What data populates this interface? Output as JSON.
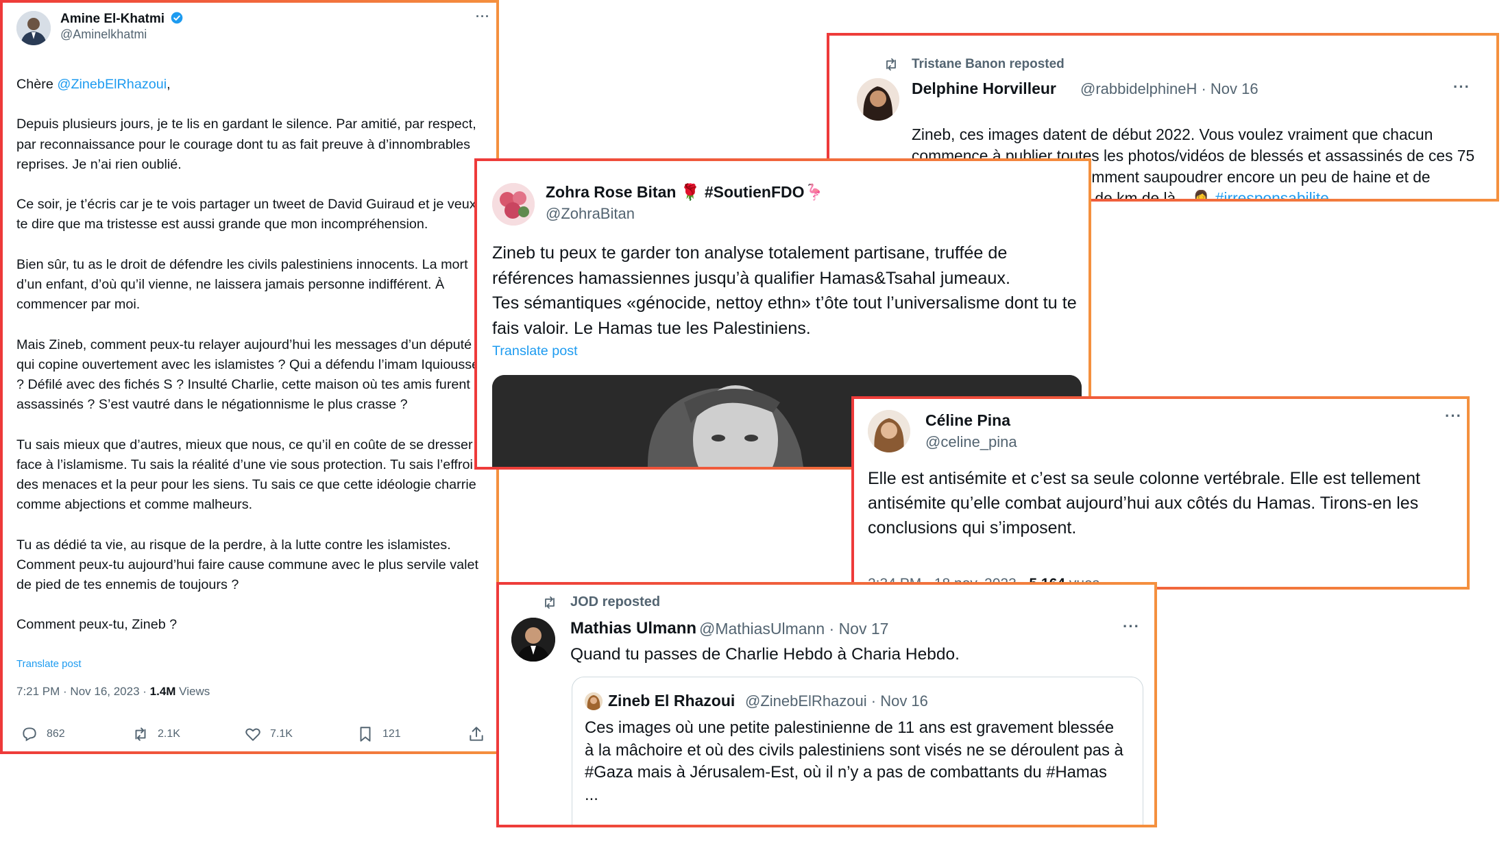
{
  "tweet_main": {
    "author_name": "Amine El-Khatmi",
    "handle": "@Aminelkhatmi",
    "greeting_prefix": "Chère ",
    "greeting_mention": "@ZinebElRhazoui",
    "greeting_suffix": ",",
    "body": "Depuis plusieurs jours, je te lis en gardant le silence. Par amitié, par respect, par reconnaissance pour le courage dont tu as fait preuve à d’innombrables reprises. Je n’ai rien oublié.\n\nCe soir, je t’écris car je te vois partager un tweet de David Guiraud et je veux te dire que ma tristesse est aussi grande que mon incompréhension.\n\nBien sûr, tu as le droit de défendre les civils palestiniens innocents. La mort d’un enfant, d’où qu’il vienne, ne laissera jamais personne indifférent. À commencer par moi.\n\nMais Zineb, comment peux-tu relayer aujourd’hui les messages d’un député qui copine ouvertement avec les islamistes ? Qui a défendu l’imam Iquioussen ? Défilé avec des fichés S ? Insulté Charlie, cette maison où tes amis furent assassinés ? S’est vautré dans le négationnisme le plus crasse ?\n\nTu sais mieux que d’autres, mieux que nous, ce qu’il en coûte de se dresser face à l’islamisme. Tu sais la réalité d’une vie sous protection. Tu sais l’effroi des menaces et la peur pour les siens. Tu sais ce que cette idéologie charrie comme abjections et comme malheurs.\n\nTu as dédié ta vie, au risque de la perdre, à la lutte contre les islamistes. Comment peux-tu aujourd’hui faire cause commune avec le plus servile valet de pied de tes ennemis de toujours ?\n\nComment peux-tu, Zineb ?",
    "translate": "Translate post",
    "timestamp": "7:21 PM · Nov 16, 2023 · ",
    "views_count": "1.4M",
    "views_label": " Views",
    "more": "···",
    "actions": {
      "replies": "862",
      "reposts": "2.1K",
      "likes": "7.1K",
      "bookmarks": "121"
    }
  },
  "tweet_delphine": {
    "repost_label": "Tristane Banon reposted",
    "author_name": "Delphine Horvilleur",
    "handle_date": "@rabbidelphineH · Nov 16",
    "more": "···",
    "body": "Zineb, ces images datent de début 2022. Vous voulez vraiment que chacun commence à publier toutes les photos/vidéos de blessés et assassinés de ces 75 dernières années ? Ou comment saupoudrer encore un peu de haine et de propagande à des milliers de km de là…🤦‍♀️ ",
    "hashtag": "#irresponsabilite"
  },
  "tweet_zohra": {
    "author_name": "Zohra Rose Bitan 🌹 #SoutienFDO🦩",
    "handle": "@ZohraBitan",
    "body": "Zineb tu peux te garder ton analyse totalement partisane, truffée de références hamassiennes jusqu’à qualifier Hamas&Tsahal jumeaux.\nTes sémantiques «génocide, nettoy ethn» t’ôte tout l’universalisme dont tu te fais valoir. Le Hamas tue les Palestiniens.",
    "translate": "Translate post"
  },
  "tweet_celine": {
    "author_name": "Céline Pina",
    "handle": "@celine_pina",
    "more": "···",
    "body": "Elle est antisémite et c’est sa seule colonne vertébrale. Elle est tellement antisémite qu’elle combat aujourd’hui aux côtés du Hamas. Tirons-en les conclusions qui s’imposent.",
    "timestamp": "2:34 PM · 18 nov. 2023 · ",
    "views_count": "5 164",
    "views_label": " vues"
  },
  "tweet_mathias": {
    "repost_label": "JOD reposted",
    "author_name": "Mathias Ulmann",
    "handle_date": "@MathiasUlmann · Nov 17",
    "more": "···",
    "body": "Quand tu passes de Charlie Hebdo à Charia Hebdo.",
    "quote": {
      "author_name": "Zineb El Rhazoui",
      "handle_date": "@ZinebElRhazoui · Nov 16",
      "body": "Ces images où une petite palestinienne de 11 ans est gravement blessée à la mâchoire et où des civils palestiniens sont visés ne se déroulent pas à #Gaza mais à Jérusalem-Est, où il n’y a pas de combattants du #Hamas\n..."
    }
  },
  "colors": {
    "link": "#1d9bf0",
    "muted": "#536471",
    "frame_start": "#ee3a3a",
    "frame_end": "#f4903e",
    "verified": "#1d9bf0"
  }
}
